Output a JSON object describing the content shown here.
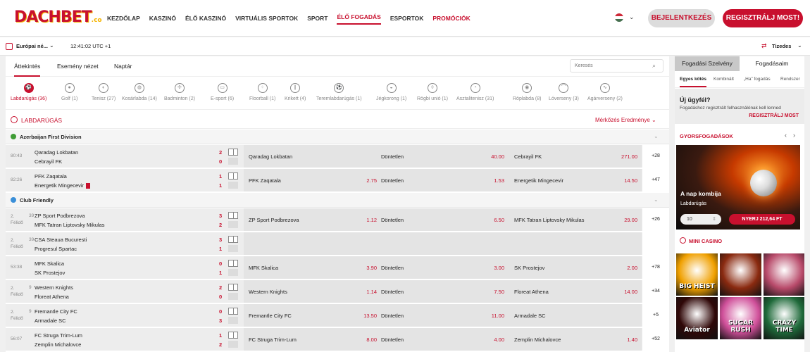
{
  "header": {
    "logo": "DACHBET",
    "logo_suffix": ".co",
    "nav": [
      "KEZDŐLAP",
      "KASZINÓ",
      "ÉLŐ KASZINÓ",
      "VIRTUÁLIS SPORTOK",
      "SPORT",
      "ÉLŐ FOGADÁS",
      "ESPORTOK",
      "PROMÓCIÓK"
    ],
    "active_nav": "ÉLŐ FOGADÁS",
    "login": "BEJELENTKEZÉS",
    "register": "REGISZTRÁLJ MOST!"
  },
  "subbar": {
    "timezone": "Európai né...",
    "clock": "12:41:02 UTC +1",
    "odds_format": "Tizedes"
  },
  "view_tabs": [
    "Áttekintés",
    "Esemény nézet",
    "Naptár"
  ],
  "search_placeholder": "Keresés",
  "sports": [
    {
      "label": "Labdarúgás (36)",
      "icon": "soccer-icon",
      "glyph": "⚽"
    },
    {
      "label": "Golf (1)",
      "icon": "golf-icon",
      "glyph": "●"
    },
    {
      "label": "Tenisz (27)",
      "icon": "tennis-icon",
      "glyph": "◐"
    },
    {
      "label": "Kosárlabda (14)",
      "icon": "basketball-icon",
      "glyph": "◍"
    },
    {
      "label": "Badminton (2)",
      "icon": "badminton-icon",
      "glyph": "✢"
    },
    {
      "label": "E-sport (6)",
      "icon": "gamepad-icon",
      "glyph": "▭"
    },
    {
      "label": "Floorball (1)",
      "icon": "floorball-icon",
      "glyph": "⁘"
    },
    {
      "label": "Krikett (4)",
      "icon": "cricket-icon",
      "glyph": "∥"
    },
    {
      "label": "Teremlabdarúgás (1)",
      "icon": "futsal-icon",
      "glyph": "⚽"
    },
    {
      "label": "Jégkorong (1)",
      "icon": "hockey-puck-icon",
      "glyph": "◒"
    },
    {
      "label": "Rögbi unió (1)",
      "icon": "rugby-icon",
      "glyph": "◊"
    },
    {
      "label": "Asztalitenisz (31)",
      "icon": "table-tennis-icon",
      "glyph": "◔"
    },
    {
      "label": "Röplabda (8)",
      "icon": "volleyball-icon",
      "glyph": "◉"
    },
    {
      "label": "Lóverseny (3)",
      "icon": "horse-racing-icon",
      "glyph": "⌒"
    },
    {
      "label": "Agárverseny (2)",
      "icon": "greyhound-icon",
      "glyph": "∿"
    }
  ],
  "section": {
    "title": "LABDARÚGÁS",
    "market": "Mérkőzés Eredménye"
  },
  "leagues": [
    {
      "name": "Azerbaijan First Division",
      "color": "#3f9c35"
    },
    {
      "name": "Club Friendly",
      "color": "#3a8fd8"
    }
  ],
  "matches_league1": [
    {
      "time": "80:43",
      "home": "Qaradag Lokbatan",
      "away": "Cebrayil FK",
      "hs": "2",
      "as": "0",
      "o1n": "Qaradag Lokbatan",
      "o1": "",
      "oxn": "Döntetlen",
      "ox": "40.00",
      "o2n": "Cebrayil FK",
      "o2": "271.00",
      "more": "+28",
      "redcard": false
    },
    {
      "time": "82:26",
      "home": "PFK Zaqatala",
      "away": "Energetik Mingecevir",
      "hs": "1",
      "as": "1",
      "o1n": "PFK Zaqatala",
      "o1": "2.75",
      "oxn": "Döntetlen",
      "ox": "1.53",
      "o2n": "Energetik Mingecevir",
      "o2": "14.50",
      "more": "+47",
      "redcard": true
    }
  ],
  "matches_league2": [
    {
      "time": "2. Félidő",
      "min": "39",
      "home": "ZP Sport Podbrezova",
      "away": "MFK Tatran Liptovsky Mikulas",
      "hs": "3",
      "as": "2",
      "o1n": "ZP Sport Podbrezova",
      "o1": "1.12",
      "oxn": "Döntetlen",
      "ox": "6.50",
      "o2n": "MFK Tatran Liptovsky Mikulas",
      "o2": "29.00",
      "more": "+26"
    },
    {
      "time": "2. Félidő",
      "min": "39",
      "home": "CSA Steaua Bucuresti",
      "away": "Progresul Spartac",
      "hs": "3",
      "as": "1",
      "o1n": "",
      "o1": "",
      "oxn": "",
      "ox": "",
      "o2n": "",
      "o2": "",
      "more": ""
    },
    {
      "time": "53:38",
      "min": "",
      "home": "MFK Skalica",
      "away": "SK Prostejov",
      "hs": "0",
      "as": "1",
      "o1n": "MFK Skalica",
      "o1": "3.90",
      "oxn": "Döntetlen",
      "ox": "3.00",
      "o2n": "SK Prostejov",
      "o2": "2.00",
      "more": "+78"
    },
    {
      "time": "2. Félidő",
      "min": "9",
      "home": "Western Knights",
      "away": "Floreat Athena",
      "hs": "2",
      "as": "0",
      "o1n": "Western Knights",
      "o1": "1.14",
      "oxn": "Döntetlen",
      "ox": "7.50",
      "o2n": "Floreat Athena",
      "o2": "14.00",
      "more": "+34"
    },
    {
      "time": "2. Félidő",
      "min": "9",
      "home": "Fremantle City FC",
      "away": "Armadale SC",
      "hs": "0",
      "as": "3",
      "o1n": "Fremantle City FC",
      "o1": "13.50",
      "oxn": "Döntetlen",
      "ox": "11.00",
      "o2n": "Armadale SC",
      "o2": "",
      "more": "+5"
    },
    {
      "time": "56:07",
      "min": "",
      "home": "FC Struga Trim-Lum",
      "away": "Zemplin Michalovce",
      "hs": "1",
      "as": "2",
      "o1n": "FC Struga Trim-Lum",
      "o1": "8.00",
      "oxn": "Döntetlen",
      "ox": "4.00",
      "o2n": "Zemplin Michalovce",
      "o2": "1.40",
      "more": "+52"
    }
  ],
  "betslip": {
    "tabs": [
      "Fogadási Szelvény",
      "Fogadásaim"
    ],
    "types": [
      "Egyes kötés",
      "Kombinált",
      "„Ha” fogadás",
      "Rendszer"
    ],
    "new_user_title": "Új ügyfél?",
    "new_user_text": "Fogadáshoz regisztrált felhasználónak kell lenned",
    "new_user_link": "REGISZTRÁLJ MOST"
  },
  "quick_bets": {
    "title": "GYORSFOGADÁSOK",
    "promo_title": "A nap kombija",
    "promo_sub": "Labdarúgás",
    "stake": "10",
    "bet_button": "NYERJ 212,64 FT"
  },
  "mini_casino": {
    "title": "MINI CASINO",
    "games": [
      {
        "name": "BIG HEIST",
        "bg": "#f0a000"
      },
      {
        "name": "",
        "bg": "#8a2a10"
      },
      {
        "name": "",
        "bg": "#b84a6a"
      },
      {
        "name": "Aviator",
        "bg": "#300808"
      },
      {
        "name": "SUGAR RUSH",
        "bg": "#d0509a"
      },
      {
        "name": "CRAZY TIME",
        "bg": "#1f6a3a"
      }
    ]
  }
}
